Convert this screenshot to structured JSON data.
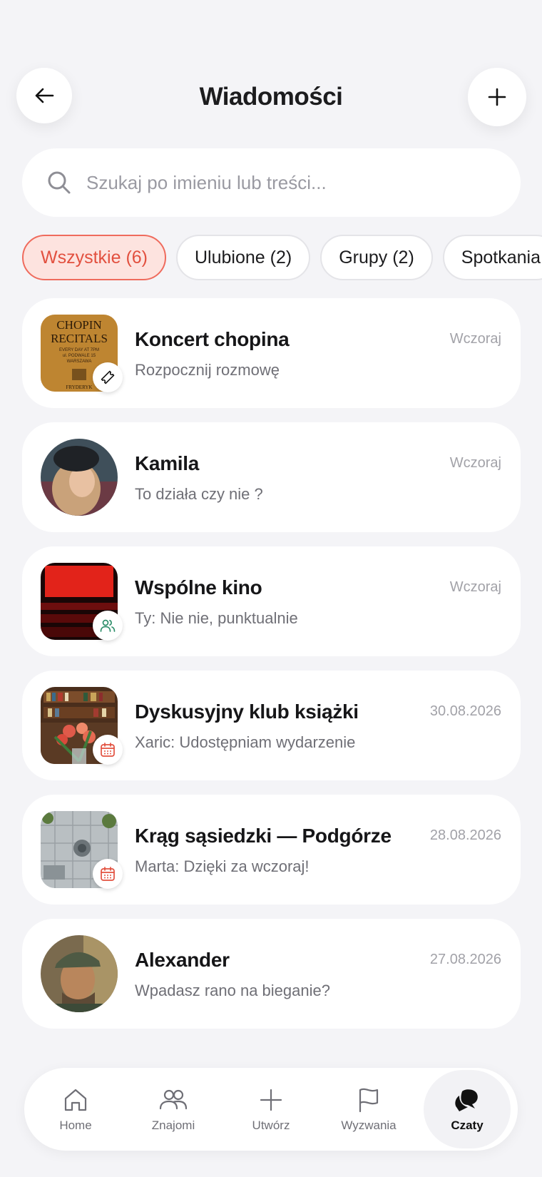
{
  "header": {
    "title": "Wiadomości",
    "back_icon": "arrow-left-icon",
    "add_icon": "plus-icon"
  },
  "search": {
    "placeholder": "Szukaj po imieniu lub treści...",
    "value": ""
  },
  "filters": [
    {
      "label": "Wszystkie (6)",
      "active": true
    },
    {
      "label": "Ulubione (2)",
      "active": false
    },
    {
      "label": "Grupy (2)",
      "active": false
    },
    {
      "label": "Spotkania",
      "active": false
    }
  ],
  "chats": [
    {
      "name": "Koncert chopina",
      "preview": "Rozpocznij rozmowę",
      "date": "Wczoraj",
      "badge": "ticket-icon"
    },
    {
      "name": "Kamila",
      "preview": "To działa czy nie ?",
      "date": "Wczoraj",
      "badge": ""
    },
    {
      "name": "Wspólne kino",
      "preview": "Ty: Nie nie, punktualnie",
      "date": "Wczoraj",
      "badge": "group-icon"
    },
    {
      "name": "Dyskusyjny klub książki",
      "preview": "Xaric: Udostępniam wydarzenie",
      "date": "30.08.2026",
      "badge": "calendar-icon"
    },
    {
      "name": "Krąg sąsiedzki — Podgórze",
      "preview": "Marta: Dzięki za wczoraj!",
      "date": "28.08.2026",
      "badge": "calendar-icon"
    },
    {
      "name": "Alexander",
      "preview": "Wpadasz rano na bieganie?",
      "date": "27.08.2026",
      "badge": ""
    }
  ],
  "poster": {
    "line1": "CHOPIN",
    "line2": "RECITALS",
    "line3": "EVERY DAY AT 7PM",
    "line4": "ul. PODWALE 15",
    "line5": "WARSZAWA",
    "line6": "FRYDERYK"
  },
  "tabbar": [
    {
      "label": "Home",
      "icon": "home-icon",
      "active": false
    },
    {
      "label": "Znajomi",
      "icon": "friends-icon",
      "active": false
    },
    {
      "label": "Utwórz",
      "icon": "plus-icon",
      "active": false
    },
    {
      "label": "Wyzwania",
      "icon": "flag-icon",
      "active": false
    },
    {
      "label": "Czaty",
      "icon": "chat-bubbles-icon",
      "active": true
    }
  ],
  "colors": {
    "accent": "#e2503f",
    "accent_bg": "#fde3df",
    "background": "#f4f4f7"
  }
}
